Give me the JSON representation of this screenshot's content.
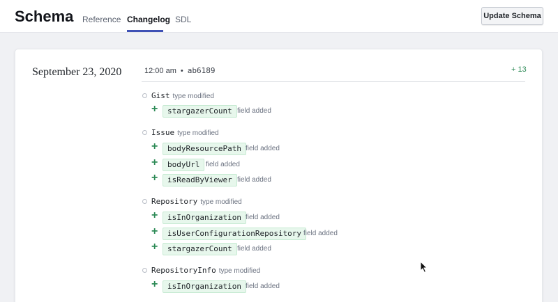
{
  "header": {
    "logo": "Schema",
    "tabs": [
      "Reference",
      "Changelog",
      "SDL"
    ],
    "active_tab": "Changelog",
    "button_label": "Update Schema"
  },
  "entry": {
    "date": "September 23, 2020",
    "time": "12:00 am",
    "separator": "•",
    "commit": "ab6189",
    "change_count": "+ 13",
    "accent_color": "#2e8b57",
    "types": [
      {
        "name": "Gist",
        "note": "type modified",
        "fields": [
          {
            "name": "stargazerCount",
            "note": "field added"
          }
        ]
      },
      {
        "name": "Issue",
        "note": "type modified",
        "fields": [
          {
            "name": "bodyResourcePath",
            "note": "field added"
          },
          {
            "name": "bodyUrl",
            "note": "field added"
          },
          {
            "name": "isReadByViewer",
            "note": "field added"
          }
        ]
      },
      {
        "name": "Repository",
        "note": "type modified",
        "fields": [
          {
            "name": "isInOrganization",
            "note": "field added"
          },
          {
            "name": "isUserConfigurationRepository",
            "note": "field added"
          },
          {
            "name": "stargazerCount",
            "note": "field added"
          }
        ]
      },
      {
        "name": "RepositoryInfo",
        "note": "type modified",
        "fields": [
          {
            "name": "isInOrganization",
            "note": "field added"
          }
        ]
      }
    ]
  }
}
